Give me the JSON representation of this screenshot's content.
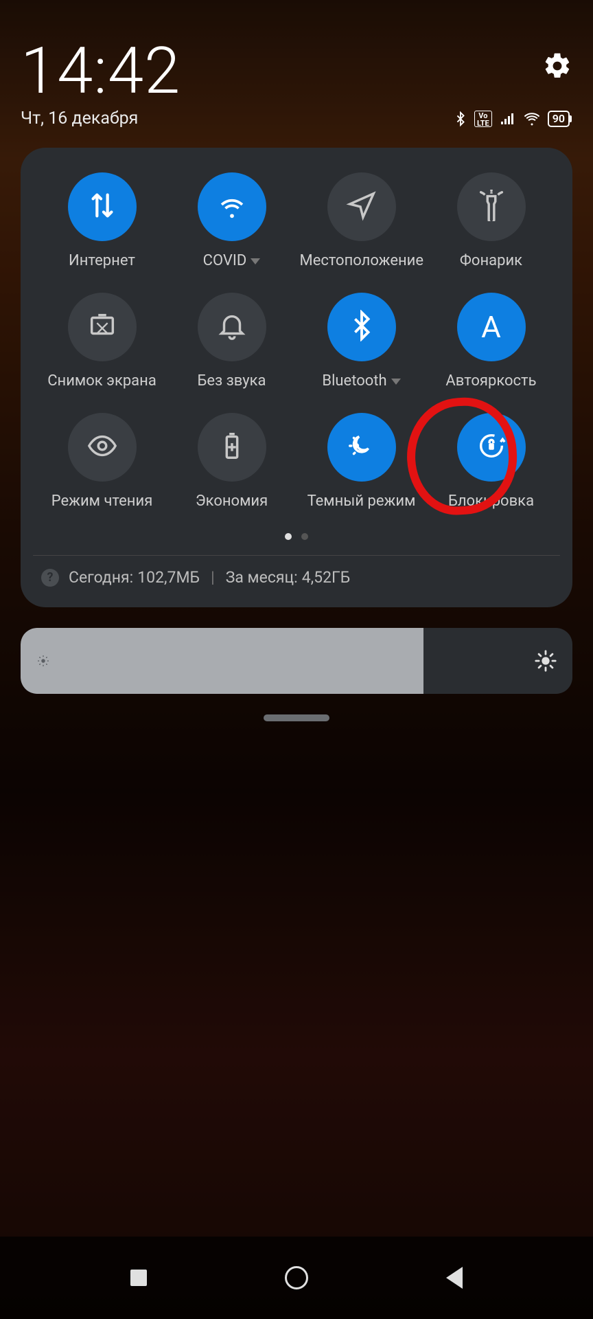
{
  "header": {
    "time": "14:42",
    "date": "Чт, 16 декабря",
    "battery_pct": "90",
    "volte_label": "Vo\nLTE"
  },
  "tiles": [
    {
      "label": "Интернет",
      "active": true,
      "expandable": false,
      "icon": "data-arrows"
    },
    {
      "label": "COVID",
      "active": true,
      "expandable": true,
      "icon": "wifi"
    },
    {
      "label": "Местоположение",
      "active": false,
      "expandable": false,
      "icon": "location"
    },
    {
      "label": "Фонарик",
      "active": false,
      "expandable": false,
      "icon": "flashlight"
    },
    {
      "label": "Снимок экрана",
      "active": false,
      "expandable": false,
      "icon": "screenshot"
    },
    {
      "label": "Без звука",
      "active": false,
      "expandable": false,
      "icon": "bell"
    },
    {
      "label": "Bluetooth",
      "active": true,
      "expandable": true,
      "icon": "bluetooth"
    },
    {
      "label": "Автояркость",
      "active": true,
      "expandable": false,
      "icon": "auto-a"
    },
    {
      "label": "Режим чтения",
      "active": false,
      "expandable": false,
      "icon": "eye"
    },
    {
      "label": "Экономия",
      "active": false,
      "expandable": false,
      "icon": "battery-plus"
    },
    {
      "label": "Темный режим",
      "active": true,
      "expandable": false,
      "icon": "dark-mode"
    },
    {
      "label": "Блокировка",
      "active": true,
      "expandable": false,
      "icon": "rotation-lock",
      "highlighted": true
    }
  ],
  "pager": {
    "count": 2,
    "active": 0
  },
  "data_usage": {
    "today_label": "Сегодня:",
    "today_value": "102,7МБ",
    "month_label": "За месяц:",
    "month_value": "4,52ГБ"
  },
  "brightness": {
    "percent": 73
  },
  "colors": {
    "accent": "#0e7fe1",
    "panel": "#2a2d31",
    "annotation": "#e21212"
  }
}
